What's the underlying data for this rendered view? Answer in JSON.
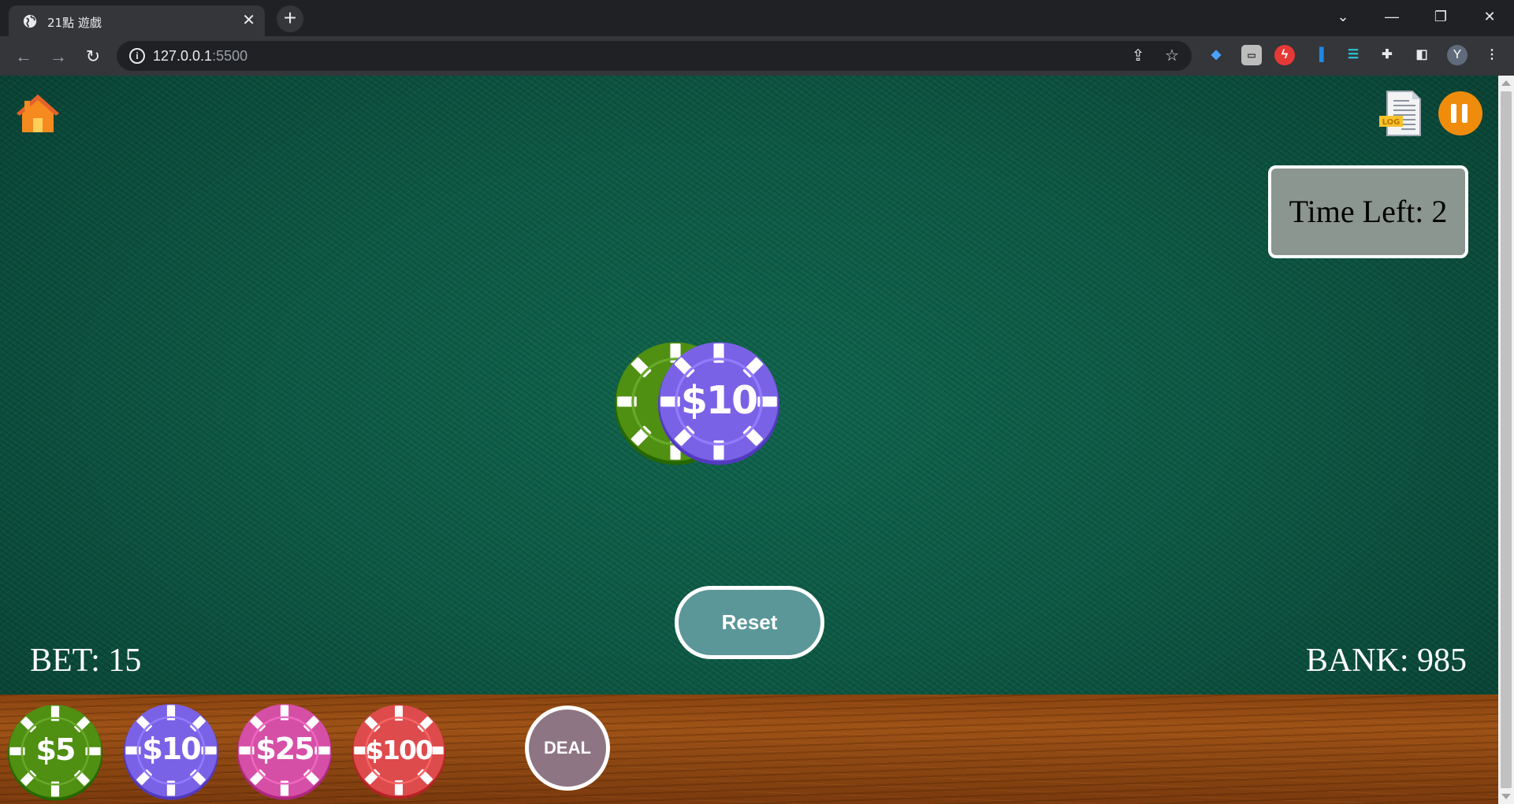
{
  "browser": {
    "tab_title": "21點 遊戲",
    "url_host": "127.0.0.1",
    "url_port": ":5500",
    "profile_initial": "Y"
  },
  "game": {
    "timer_label": "Time Left: 2",
    "bet_label": "BET: 15",
    "bank_label": "BANK: 985",
    "reset_label": "Reset",
    "deal_label": "DEAL",
    "log_badge": "LOG",
    "table_chips": [
      {
        "label": "",
        "color": "#4f8f12"
      },
      {
        "label": "$10",
        "color": "#7a62e6"
      }
    ],
    "rack_chips": [
      {
        "label": "$5",
        "color": "#4f8f12"
      },
      {
        "label": "$10",
        "color": "#7a62e6"
      },
      {
        "label": "$25",
        "color": "#d64fa6"
      },
      {
        "label": "$100",
        "color": "#dd4b4d"
      }
    ]
  },
  "colors": {
    "felt": "#0e5a45",
    "pause": "#f08c0c",
    "reset": "#5b9799",
    "deal": "#8e7584",
    "timer_bg": "#8c9691"
  }
}
